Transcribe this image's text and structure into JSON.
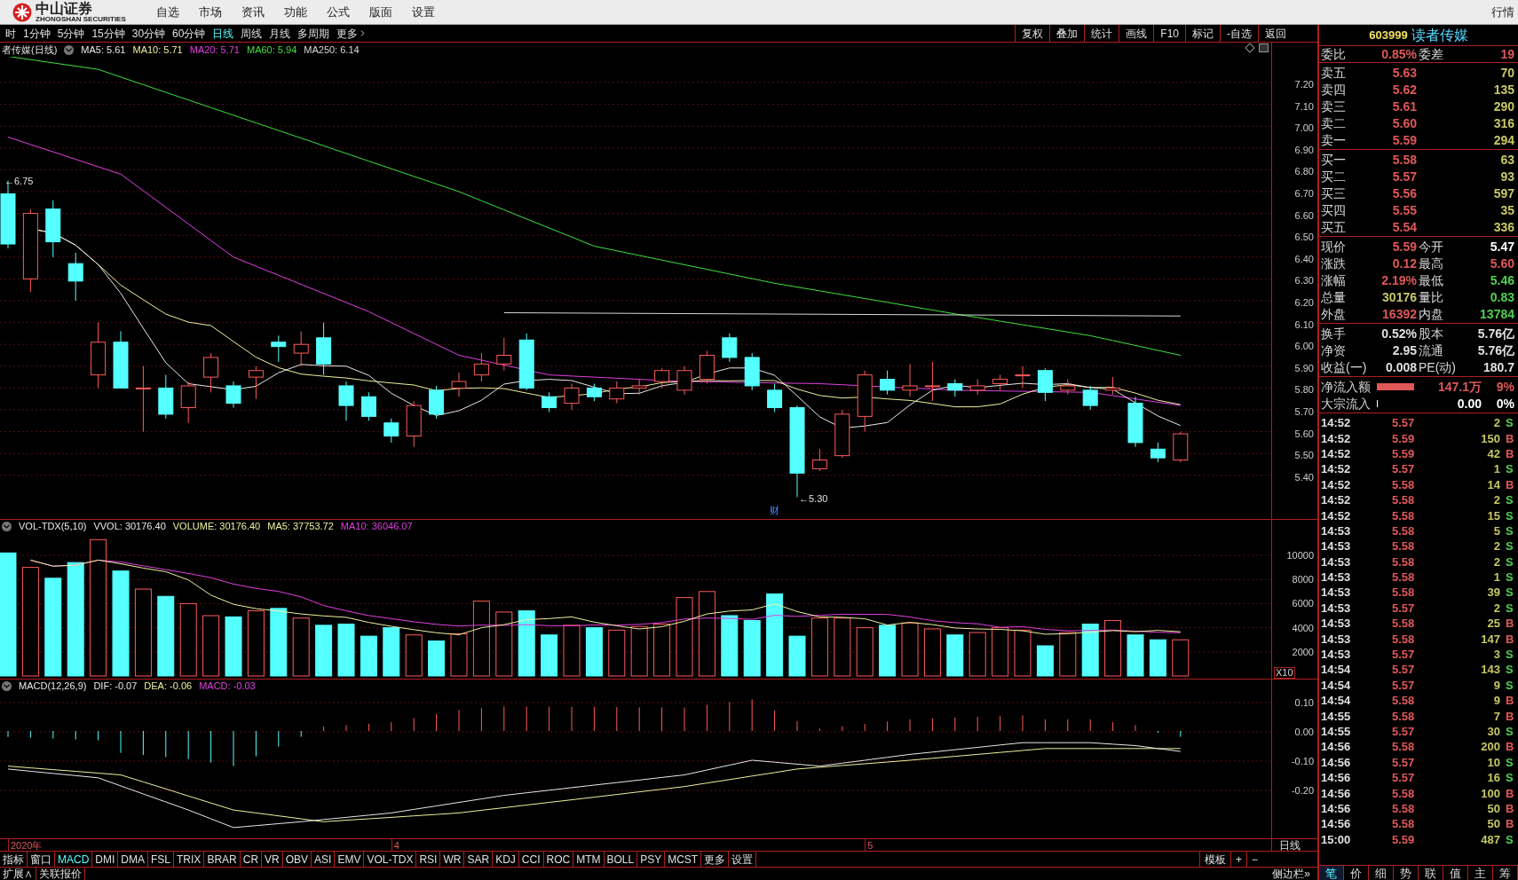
{
  "menu_bar": {
    "logo_text": "中山证券",
    "logo_subtext": "ZHONGSHAN SECURITIES",
    "items": [
      "自选",
      "市场",
      "资讯",
      "功能",
      "公式",
      "版面",
      "设置"
    ],
    "right_label": "行情"
  },
  "period_tabs": [
    {
      "label": "时",
      "selected": false
    },
    {
      "label": "1分钟",
      "selected": false
    },
    {
      "label": "5分钟",
      "selected": false
    },
    {
      "label": "15分钟",
      "selected": false
    },
    {
      "label": "30分钟",
      "selected": false
    },
    {
      "label": "60分钟",
      "selected": false
    },
    {
      "label": "日线",
      "selected": true
    },
    {
      "label": "周线",
      "selected": false
    },
    {
      "label": "月线",
      "selected": false
    },
    {
      "label": "多周期",
      "selected": false
    },
    {
      "label": "更多",
      "selected": false
    }
  ],
  "chart_tools": [
    "复权",
    "叠加",
    "统计",
    "画线",
    "F10",
    "标记",
    "-自选",
    "返回"
  ],
  "price_pane": {
    "title": "者传媒(日线)",
    "indicators": [
      {
        "label": "MA5: 5.61",
        "color": "#e8e8e8"
      },
      {
        "label": "MA10: 5.71",
        "color": "#f0f0a0"
      },
      {
        "label": "MA20: 5.71",
        "color": "#e040e0"
      },
      {
        "label": "MA60: 5.94",
        "color": "#40e040"
      },
      {
        "label": "MA250: 6.14",
        "color": "#d8d8d8"
      }
    ],
    "axis_ticks": [
      "7.20",
      "7.10",
      "7.00",
      "6.90",
      "6.80",
      "6.70",
      "6.60",
      "6.50",
      "6.40",
      "6.30",
      "6.20",
      "6.10",
      "6.00",
      "5.90",
      "5.80",
      "5.70",
      "5.60",
      "5.50",
      "5.40"
    ],
    "high_marker": "←6.75",
    "low_marker": "←5.30",
    "event_mark": "财"
  },
  "volume_pane": {
    "indicators": [
      {
        "label": "VOL-TDX(5,10)",
        "color": "#e8e8e8"
      },
      {
        "label": "VVOL: 30176.40",
        "color": "#e8e8e8"
      },
      {
        "label": "VOLUME: 30176.40",
        "color": "#f0f0a0"
      },
      {
        "label": "MA5: 37753.72",
        "color": "#f0f0a0"
      },
      {
        "label": "MA10: 36046.07",
        "color": "#e040e0"
      }
    ],
    "axis_ticks": [
      "10000",
      "8000",
      "6000",
      "4000",
      "2000"
    ],
    "scale_label": "X10"
  },
  "macd_pane": {
    "indicators": [
      {
        "label": "MACD(12,26,9)",
        "color": "#e8e8e8"
      },
      {
        "label": "DIF: -0.07",
        "color": "#e8e8e8"
      },
      {
        "label": "DEA: -0.06",
        "color": "#f0f0a0"
      },
      {
        "label": "MACD: -0.03",
        "color": "#e040e0"
      }
    ],
    "axis_ticks": [
      "0.10",
      "0.00",
      "-0.10",
      "-0.20"
    ]
  },
  "date_axis": [
    "2020年",
    "4",
    "5"
  ],
  "period_label": "日线",
  "indicator_tabs": [
    {
      "label": "指标",
      "selected": false
    },
    {
      "label": "窗口",
      "selected": false
    },
    {
      "label": "MACD",
      "selected": true
    },
    {
      "label": "DMI",
      "selected": false
    },
    {
      "label": "DMA",
      "selected": false
    },
    {
      "label": "FSL",
      "selected": false
    },
    {
      "label": "TRIX",
      "selected": false
    },
    {
      "label": "BRAR",
      "selected": false
    },
    {
      "label": "CR",
      "selected": false
    },
    {
      "label": "VR",
      "selected": false
    },
    {
      "label": "OBV",
      "selected": false
    },
    {
      "label": "ASI",
      "selected": false
    },
    {
      "label": "EMV",
      "selected": false
    },
    {
      "label": "VOL-TDX",
      "selected": false
    },
    {
      "label": "RSI",
      "selected": false
    },
    {
      "label": "WR",
      "selected": false
    },
    {
      "label": "SAR",
      "selected": false
    },
    {
      "label": "KDJ",
      "selected": false
    },
    {
      "label": "CCI",
      "selected": false
    },
    {
      "label": "ROC",
      "selected": false
    },
    {
      "label": "MTM",
      "selected": false
    },
    {
      "label": "BOLL",
      "selected": false
    },
    {
      "label": "PSY",
      "selected": false
    },
    {
      "label": "MCST",
      "selected": false
    },
    {
      "label": "更多",
      "selected": false
    },
    {
      "label": "设置",
      "selected": false
    }
  ],
  "template_controls": [
    "模板",
    "+",
    "−"
  ],
  "footer": {
    "items": [
      "扩展∧",
      "关联报价"
    ],
    "sidebar_toggle": "侧边栏»"
  },
  "quote": {
    "code": "603999",
    "name": "读者传媒",
    "ratio": [
      {
        "label": "委比",
        "value": "0.85%",
        "color": "#e05858"
      },
      {
        "label": "委差",
        "value": "19",
        "color": "#e05858"
      }
    ],
    "order_book": [
      {
        "label": "卖五",
        "price": "5.63",
        "volume": "70"
      },
      {
        "label": "卖四",
        "price": "5.62",
        "volume": "135"
      },
      {
        "label": "卖三",
        "price": "5.61",
        "volume": "290"
      },
      {
        "label": "卖二",
        "price": "5.60",
        "volume": "316"
      },
      {
        "label": "卖一",
        "price": "5.59",
        "volume": "294"
      },
      {
        "label": "买一",
        "price": "5.58",
        "volume": "63"
      },
      {
        "label": "买二",
        "price": "5.57",
        "volume": "93"
      },
      {
        "label": "买三",
        "price": "5.56",
        "volume": "597"
      },
      {
        "label": "买四",
        "price": "5.55",
        "volume": "35"
      },
      {
        "label": "买五",
        "price": "5.54",
        "volume": "336"
      }
    ],
    "stats": [
      [
        {
          "label": "现价",
          "value": "5.59",
          "color": "#e05858"
        },
        {
          "label": "今开",
          "value": "5.47",
          "color": "#ffffff"
        }
      ],
      [
        {
          "label": "涨跌",
          "value": "0.12",
          "color": "#e05858"
        },
        {
          "label": "最高",
          "value": "5.60",
          "color": "#e05858"
        }
      ],
      [
        {
          "label": "涨幅",
          "value": "2.19%",
          "color": "#e05858"
        },
        {
          "label": "最低",
          "value": "5.46",
          "color": "#50d050"
        }
      ],
      [
        {
          "label": "总量",
          "value": "30176",
          "color": "#c8c864"
        },
        {
          "label": "量比",
          "value": "0.83",
          "color": "#50d050"
        }
      ],
      [
        {
          "label": "外盘",
          "value": "16392",
          "color": "#e05858"
        },
        {
          "label": "内盘",
          "value": "13784",
          "color": "#50d050"
        }
      ]
    ],
    "capital": [
      [
        {
          "label": "换手",
          "value": "0.52%",
          "color": "#e0e0e0"
        },
        {
          "label": "股本",
          "value": "5.76亿",
          "color": "#e0e0e0"
        }
      ],
      [
        {
          "label": "净资",
          "value": "2.95",
          "color": "#e0e0e0"
        },
        {
          "label": "流通",
          "value": "5.76亿",
          "color": "#e0e0e0"
        }
      ],
      [
        {
          "label": "收益(一)",
          "value": "0.008",
          "color": "#e0e0e0"
        },
        {
          "label": "PE(动)",
          "value": "180.7",
          "color": "#e0e0e0"
        }
      ]
    ],
    "flows": [
      {
        "label": "净流入额",
        "amount": "147.1万",
        "percent": "9%",
        "color": "#e05858",
        "kind": "bar"
      },
      {
        "label": "大宗流入",
        "amount": "0.00",
        "percent": "0%",
        "color": "#ffffff",
        "kind": "tick"
      }
    ]
  },
  "trades": [
    {
      "time": "14:52",
      "price": "5.57",
      "volume": "2",
      "side": "S",
      "kind": "sell"
    },
    {
      "time": "14:52",
      "price": "5.59",
      "volume": "150",
      "side": "B",
      "kind": "buy"
    },
    {
      "time": "14:52",
      "price": "5.59",
      "volume": "42",
      "side": "B",
      "kind": "buy"
    },
    {
      "time": "14:52",
      "price": "5.57",
      "volume": "1",
      "side": "S",
      "kind": "sell"
    },
    {
      "time": "14:52",
      "price": "5.58",
      "volume": "14",
      "side": "B",
      "kind": "buy"
    },
    {
      "time": "14:52",
      "price": "5.58",
      "volume": "2",
      "side": "S",
      "kind": "sell"
    },
    {
      "time": "14:52",
      "price": "5.58",
      "volume": "15",
      "side": "S",
      "kind": "sell"
    },
    {
      "time": "14:53",
      "price": "5.58",
      "volume": "5",
      "side": "S",
      "kind": "sell"
    },
    {
      "time": "14:53",
      "price": "5.58",
      "volume": "2",
      "side": "S",
      "kind": "sell"
    },
    {
      "time": "14:53",
      "price": "5.58",
      "volume": "2",
      "side": "S",
      "kind": "sell"
    },
    {
      "time": "14:53",
      "price": "5.58",
      "volume": "1",
      "side": "S",
      "kind": "sell"
    },
    {
      "time": "14:53",
      "price": "5.58",
      "volume": "39",
      "side": "S",
      "kind": "sell"
    },
    {
      "time": "14:53",
      "price": "5.57",
      "volume": "2",
      "side": "S",
      "kind": "sell"
    },
    {
      "time": "14:53",
      "price": "5.58",
      "volume": "25",
      "side": "B",
      "kind": "buy"
    },
    {
      "time": "14:53",
      "price": "5.58",
      "volume": "147",
      "side": "B",
      "kind": "buy"
    },
    {
      "time": "14:53",
      "price": "5.57",
      "volume": "3",
      "side": "S",
      "kind": "sell"
    },
    {
      "time": "14:54",
      "price": "5.57",
      "volume": "143",
      "side": "S",
      "kind": "sell"
    },
    {
      "time": "14:54",
      "price": "5.57",
      "volume": "9",
      "side": "S",
      "kind": "sell"
    },
    {
      "time": "14:54",
      "price": "5.58",
      "volume": "9",
      "side": "B",
      "kind": "buy"
    },
    {
      "time": "14:55",
      "price": "5.58",
      "volume": "7",
      "side": "B",
      "kind": "buy"
    },
    {
      "time": "14:55",
      "price": "5.57",
      "volume": "30",
      "side": "S",
      "kind": "sell"
    },
    {
      "time": "14:56",
      "price": "5.58",
      "volume": "200",
      "side": "B",
      "kind": "buy"
    },
    {
      "time": "14:56",
      "price": "5.57",
      "volume": "10",
      "side": "S",
      "kind": "sell"
    },
    {
      "time": "14:56",
      "price": "5.57",
      "volume": "16",
      "side": "S",
      "kind": "sell"
    },
    {
      "time": "14:56",
      "price": "5.58",
      "volume": "100",
      "side": "B",
      "kind": "buy"
    },
    {
      "time": "14:56",
      "price": "5.58",
      "volume": "50",
      "side": "B",
      "kind": "buy"
    },
    {
      "time": "14:56",
      "price": "5.58",
      "volume": "50",
      "side": "B",
      "kind": "buy"
    },
    {
      "time": "15:00",
      "price": "5.59",
      "volume": "487",
      "side": "S",
      "kind": "sell"
    }
  ],
  "panel_tabs": [
    {
      "label": "笔",
      "selected": true
    },
    {
      "label": "价",
      "selected": false
    },
    {
      "label": "细",
      "selected": false
    },
    {
      "label": "势",
      "selected": false
    },
    {
      "label": "联",
      "selected": false
    },
    {
      "label": "值",
      "selected": false
    },
    {
      "label": "主",
      "selected": false
    },
    {
      "label": "筹",
      "selected": false
    }
  ]
}
